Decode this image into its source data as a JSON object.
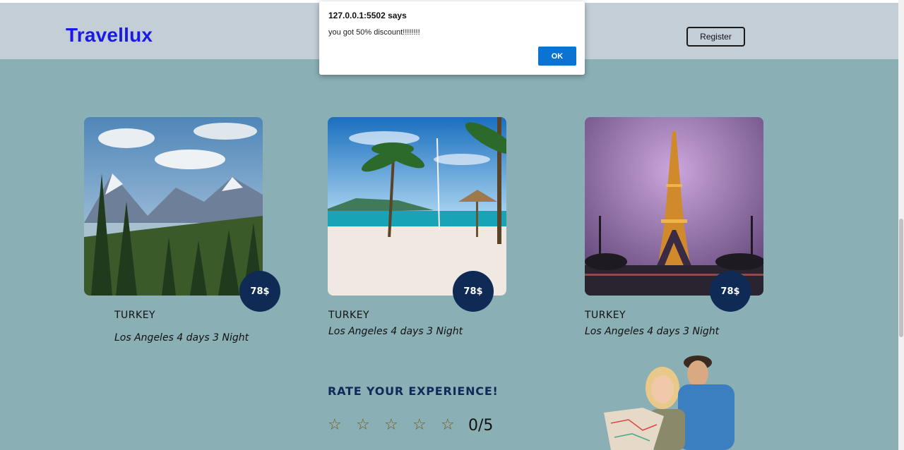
{
  "header": {
    "logo": "Travellux",
    "register_label": "Register"
  },
  "cards": [
    {
      "image": "mountain-landscape",
      "price": "78$",
      "title": "TURKEY",
      "desc": "Los Angeles 4 days 3 Night"
    },
    {
      "image": "tropical-beach",
      "price": "78$",
      "title": "TURKEY",
      "desc": "Los Angeles 4 days 3 Night"
    },
    {
      "image": "eiffel-tower-dusk",
      "price": "78$",
      "title": "TURKEY",
      "desc": "Los Angeles 4 days 3 Night"
    }
  ],
  "rating": {
    "title": "RATE YOUR EXPERIENCE!",
    "star_glyph": "☆",
    "score": "0/5"
  },
  "dialog": {
    "title": "127.0.0.1:5502 says",
    "message": "you got 50% discount!!!!!!!!",
    "ok_label": "OK"
  },
  "colors": {
    "background": "#8aafb5",
    "header": "#c3ced7",
    "logo": "#1a1ae6",
    "price_badge": "#0e2a55",
    "ok_button": "#0b73d1"
  }
}
